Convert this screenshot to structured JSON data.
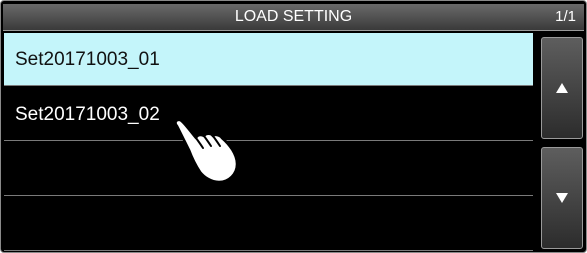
{
  "header": {
    "title": "LOAD SETTING",
    "page_indicator": "1/1"
  },
  "list": {
    "items": [
      {
        "label": "Set20171003_01",
        "selected": true
      },
      {
        "label": "Set20171003_02",
        "selected": false
      },
      {
        "label": "",
        "selected": false
      },
      {
        "label": "",
        "selected": false
      }
    ]
  },
  "scroll": {
    "up_icon": "triangle-up-icon",
    "down_icon": "triangle-down-icon"
  },
  "overlay": {
    "pointer_icon": "pointing-hand-icon"
  },
  "colors": {
    "background": "#000000",
    "selected_row": "#c4f5fa",
    "titlebar": "#4a4a4a",
    "text": "#ffffff"
  }
}
